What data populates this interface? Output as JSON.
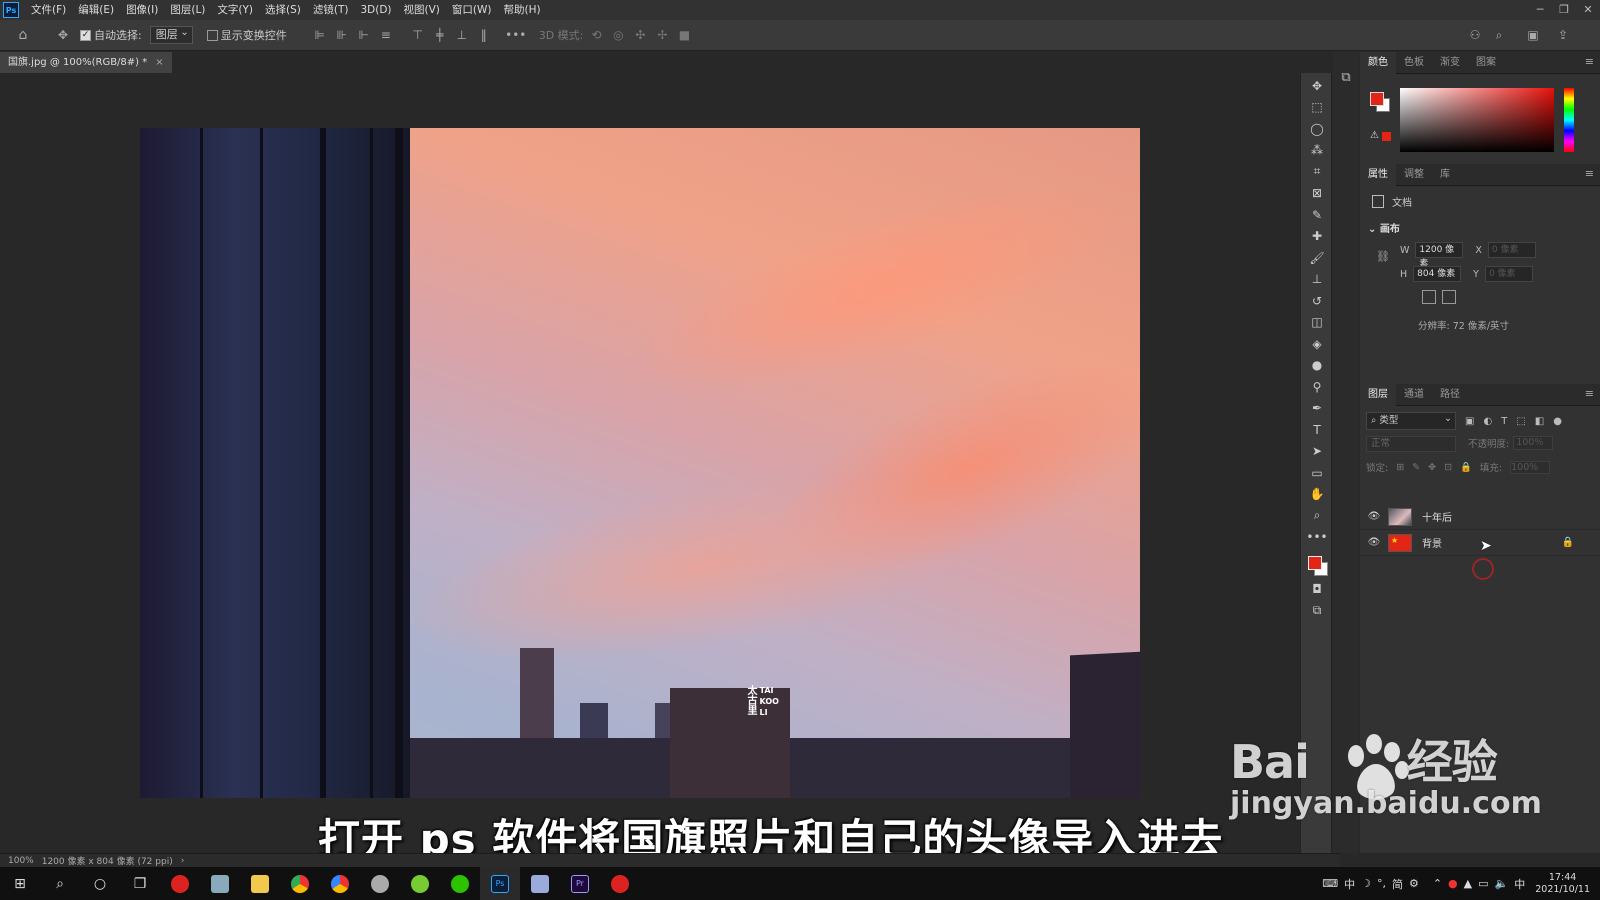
{
  "app": {
    "logo": "Ps"
  },
  "menu": [
    "文件(F)",
    "编辑(E)",
    "图像(I)",
    "图层(L)",
    "文字(Y)",
    "选择(S)",
    "滤镜(T)",
    "3D(D)",
    "视图(V)",
    "窗口(W)",
    "帮助(H)"
  ],
  "options": {
    "auto_select": "自动选择:",
    "auto_select_target": "图层",
    "show_transform": "显示变换控件",
    "mode_3d": "3D 模式:"
  },
  "document": {
    "tab_title": "国旗.jpg @ 100%(RGB/8#) *",
    "zoom": "100%",
    "size_info": "1200 像素 x 804 像素 (72 ppi)"
  },
  "subtitle": "打开 ps 软件将国旗照片和自己的头像导入进去",
  "photo_sign": "太古里",
  "photo_sign2": "TAI KOO LI",
  "color_panel": {
    "tabs": [
      "颜色",
      "色板",
      "渐变",
      "图案"
    ],
    "fg": "#e42515",
    "bg": "#ffffff"
  },
  "properties_panel": {
    "tabs": [
      "属性",
      "调整",
      "库"
    ],
    "doc_label": "文档",
    "section": "画布",
    "w_label": "W",
    "w_value": "1200 像素",
    "h_label": "H",
    "h_value": "804 像素",
    "x_label": "X",
    "x_value": "0 像素",
    "y_label": "Y",
    "y_value": "0 像素",
    "resolution": "分辨率: 72 像素/英寸"
  },
  "layers_panel": {
    "tabs": [
      "图层",
      "通道",
      "路径"
    ],
    "filter": "类型",
    "blend": "正常",
    "opacity_label": "不透明度:",
    "opacity": "100%",
    "lock_label": "锁定:",
    "fill_label": "填充:",
    "fill": "100%",
    "layers": [
      {
        "name": "十年后",
        "visible": true,
        "locked": false
      },
      {
        "name": "背景",
        "visible": true,
        "locked": true
      }
    ]
  },
  "watermark": {
    "brand": "Bai",
    "brand2": "经验",
    "url": "jingyan.baidu.com"
  },
  "taskbar": {
    "ime": "中",
    "ime2": "简",
    "time": "17:44",
    "date": "2021/10/11"
  }
}
